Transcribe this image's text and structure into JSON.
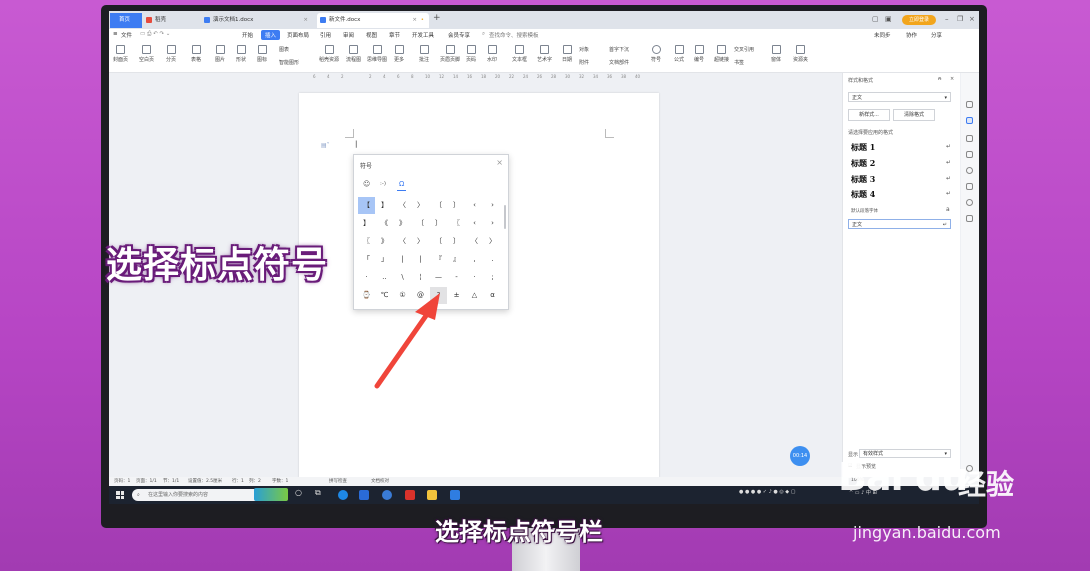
{
  "tabs": [
    {
      "label": "首页"
    },
    {
      "label": "稻壳"
    },
    {
      "label": "演示文档1.docx"
    },
    {
      "label": "新文件.docx"
    }
  ],
  "login_label": "立即登录",
  "menu": {
    "file": "文件",
    "items": [
      "开始",
      "插入",
      "页面布局",
      "引用",
      "审阅",
      "视图",
      "章节",
      "开发工具",
      "会员专享"
    ],
    "active": "插入",
    "search_placeholder": "查找命令、搜索模板",
    "right": [
      "未同步",
      "协作",
      "分享"
    ]
  },
  "ribbon": {
    "buttons": [
      "封面页",
      "空白页",
      "分页",
      "表格",
      "图片",
      "形状",
      "图标",
      "智能图形",
      "稻壳资源",
      "流程图",
      "思维导图",
      "更多",
      "批注",
      "页眉页脚",
      "页码",
      "水印",
      "文本框",
      "艺术字",
      "日期",
      "附件",
      "文档部件",
      "符号",
      "公式",
      "编号",
      "超链接",
      "书签",
      "窗体",
      "资源夹"
    ],
    "extra": [
      "图表",
      "对象",
      "首字下沉",
      "交叉引用"
    ]
  },
  "ruler_numbers": [
    "6",
    "4",
    "2",
    "",
    "2",
    "4",
    "6",
    "8",
    "10",
    "12",
    "14",
    "16",
    "18",
    "20",
    "22",
    "24",
    "26",
    "28",
    "30",
    "32",
    "34",
    "36",
    "38",
    "40"
  ],
  "symbol_dialog": {
    "title": "符号",
    "categories": [
      "☺",
      ":-)",
      "Ω"
    ],
    "symbols": [
      [
        "【",
        "】",
        "〈",
        "〉",
        "〔",
        "〕",
        "‹",
        "›"
      ],
      [
        "】",
        "《",
        "》",
        "〔",
        "〕",
        "〖",
        "‹",
        "›"
      ],
      [
        "〖",
        "》",
        "〈",
        "〉",
        "〔",
        "〕",
        "〈",
        "〉"
      ],
      [
        "「",
        "」",
        "|",
        "|",
        "『",
        "』",
        ",",
        "."
      ],
      [
        "·",
        "‥",
        "\\",
        "¦",
        "—",
        "-",
        "·",
        ";"
      ],
      [
        "⌚",
        "℃",
        "①",
        "@",
        "?",
        "±",
        "△",
        "α"
      ]
    ],
    "selected_symbol": "【",
    "hover_symbol": "?"
  },
  "style_panel": {
    "header": "样式和格式",
    "current_style": "正文",
    "new_style_button": "新样式...",
    "clear_format_button": "清除格式",
    "apply_label": "请选择要应用的格式",
    "headings": [
      "标题 1",
      "标题 2",
      "标题 3",
      "标题 4"
    ],
    "default_font_label": "默认段落字体",
    "body_style": "正文",
    "display_label": "显示",
    "display_value": "有效样式",
    "preview_label": "显示预览"
  },
  "time_badge": "00:14",
  "status_bar": [
    "页码：1",
    "页面：1/1",
    "节：1/1",
    "设置值：2.5厘米",
    "行：1",
    "列：2",
    "字数：1",
    "拼写检查",
    "文档校对"
  ],
  "zoom": "100%",
  "taskbar": {
    "search_placeholder": "在这里输入你要搜索的内容"
  },
  "overlay_left": "选择标点符号",
  "overlay_bottom": "选择标点符号栏",
  "watermark": {
    "brand": "Bai du",
    "cn": "经验",
    "url": "jingyan.baidu.com"
  },
  "colors": {
    "accent": "#3d7cf2",
    "background": "#c85ad2",
    "arrow": "#f0453a"
  }
}
